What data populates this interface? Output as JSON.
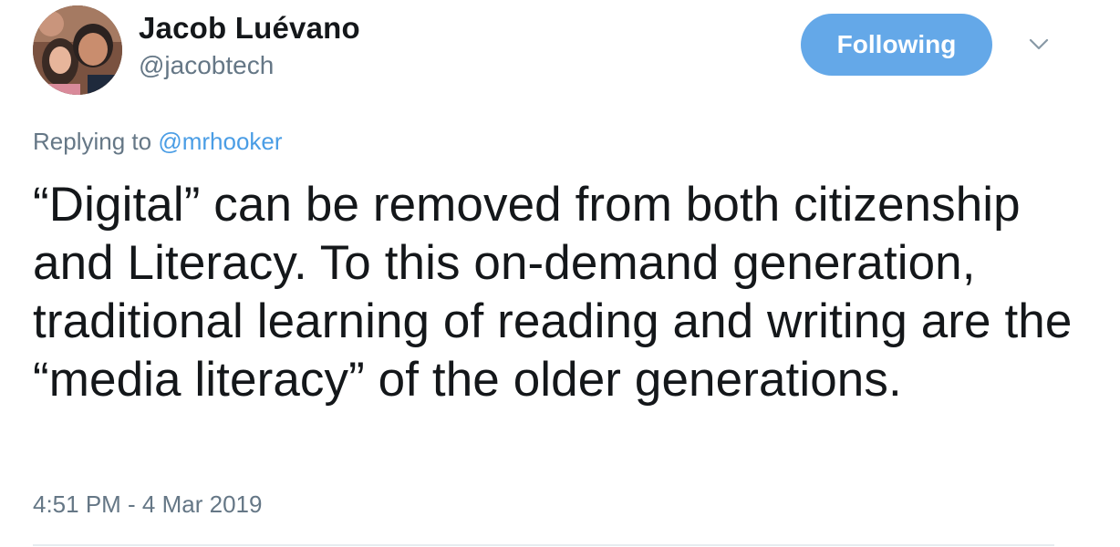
{
  "author": {
    "display_name": "Jacob Luévano",
    "handle": "@jacobtech"
  },
  "actions": {
    "follow_label": "Following",
    "caret_icon": "chevron-down-icon"
  },
  "reply": {
    "prefix": "Replying to ",
    "mention": "@mrhooker"
  },
  "tweet": {
    "text": "“Digital” can be removed from both citizenship and Literacy. To this on-demand generation, traditional learning of reading and writing are the “media literacy” of the older generations.",
    "timestamp": "4:51 PM - 4 Mar 2019"
  },
  "colors": {
    "follow_button_bg": "#64a8e8",
    "link": "#4a9de5",
    "secondary_text": "#657786",
    "primary_text": "#14171a"
  }
}
